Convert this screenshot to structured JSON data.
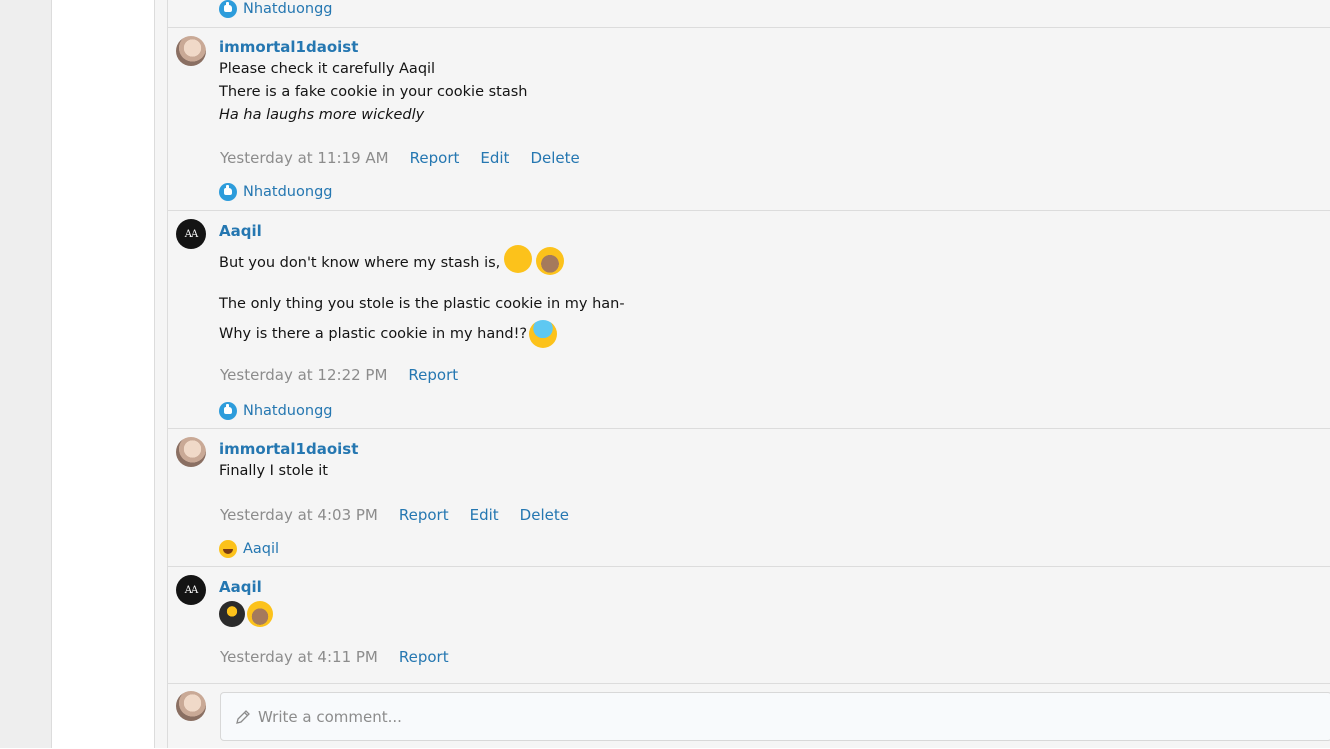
{
  "reactions": {
    "like_icon": "thumbs-up-icon",
    "laugh_icon": "rofl-icon"
  },
  "top_reaction": {
    "user": "Nhatduongg"
  },
  "comments": [
    {
      "author": "immortal1daoist",
      "lines": [
        "Please check it carefully Aaqil",
        "There is a fake cookie in your cookie stash",
        "Ha ha laughs more wickedly"
      ],
      "time": "Yesterday at 11:19 AM",
      "actions": [
        "Report",
        "Edit",
        "Delete"
      ],
      "reaction_user": "Nhatduongg"
    },
    {
      "author": "Aaqil",
      "avatar_text": "AA",
      "lines": [
        "But you don't know where my stash is,",
        "The only thing you stole is the plastic cookie in my han-",
        "Why is there a plastic cookie in my hand!?"
      ],
      "time": "Yesterday at 12:22 PM",
      "actions": [
        "Report"
      ],
      "reaction_user": "Nhatduongg"
    },
    {
      "author": "immortal1daoist",
      "lines": [
        "Finally I stole it"
      ],
      "time": "Yesterday at 4:03 PM",
      "actions": [
        "Report",
        "Edit",
        "Delete"
      ],
      "reaction_user": "Aaqil"
    },
    {
      "author": "Aaqil",
      "avatar_text": "AA",
      "lines": [],
      "time": "Yesterday at 4:11 PM",
      "actions": [
        "Report"
      ]
    }
  ],
  "comment_form": {
    "placeholder": "Write a comment..."
  },
  "colors": {
    "link": "#2577b1",
    "muted": "#8c8c8c",
    "panel": "#f5f5f5",
    "like": "#2d9cdb"
  }
}
